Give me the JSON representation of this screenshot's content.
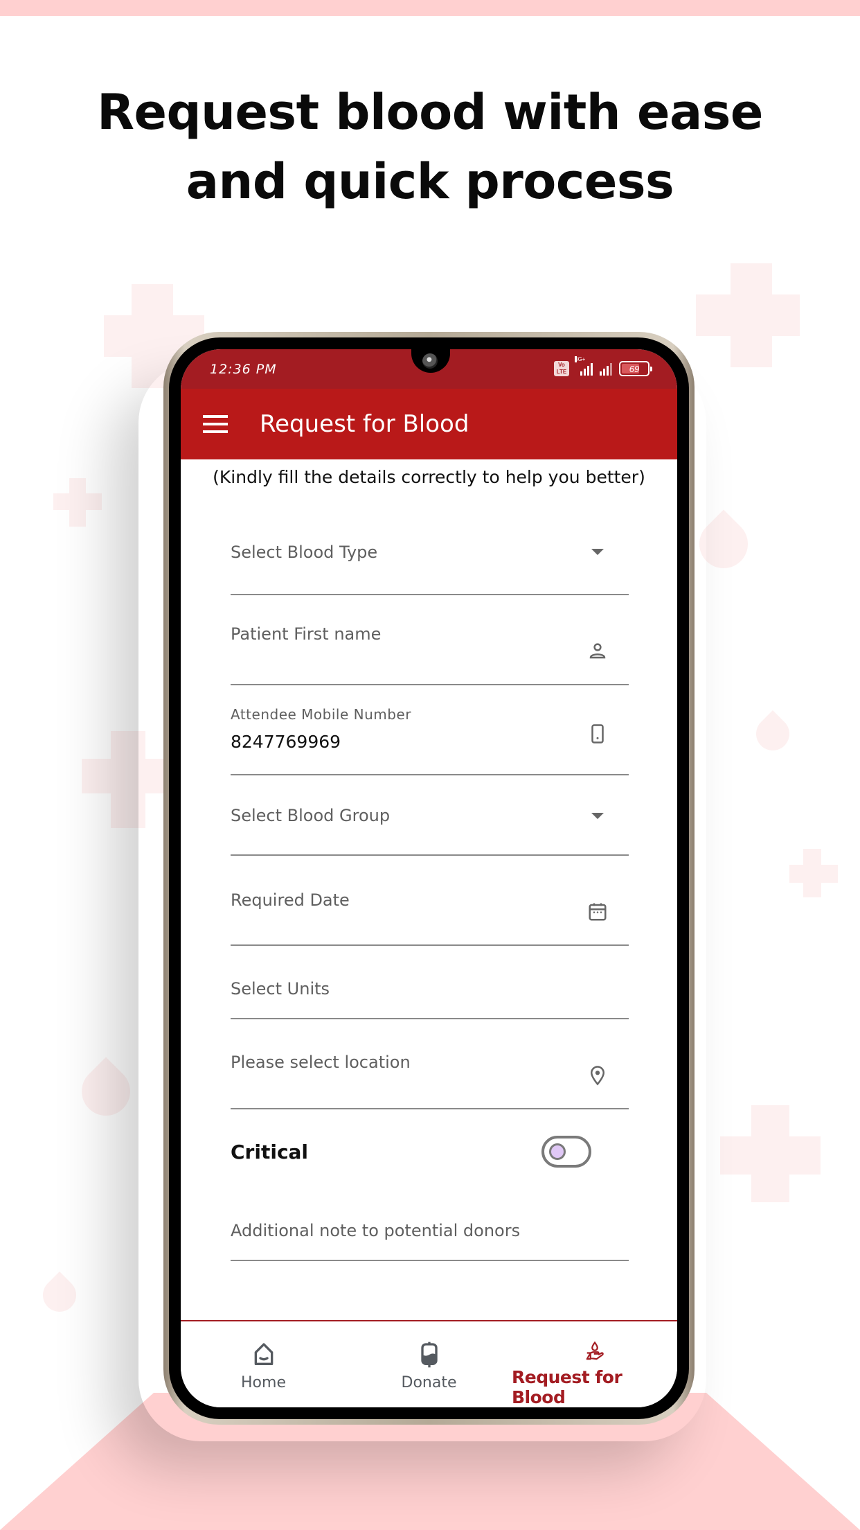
{
  "marketing": {
    "headline_line1": "Request blood with ease",
    "headline_line2": "and quick process"
  },
  "colors": {
    "brand_red": "#b91919",
    "status_bar_red": "#a31c22",
    "background_pink": "#ffd0d0",
    "toggle_knob": "#e0c8f6"
  },
  "status_bar": {
    "time": "12:36 PM",
    "volte_icon": "volte-icon",
    "network_label": "4G+",
    "battery_percent": "69",
    "battery_level": 0.69
  },
  "app_bar": {
    "menu_icon": "hamburger-menu-icon",
    "title": "Request for Blood"
  },
  "form": {
    "instructions": "(Kindly fill the details correctly to help you better)",
    "fields": [
      {
        "key": "blood_type",
        "placeholder": "Select Blood Type",
        "value": "",
        "icon": "dropdown-caret-icon"
      },
      {
        "key": "patient_first_name",
        "placeholder": "Patient First name",
        "value": "",
        "icon": "person-icon"
      },
      {
        "key": "attendee_mobile",
        "label": "Attendee Mobile Number",
        "value": "8247769969",
        "icon": "smartphone-icon"
      },
      {
        "key": "blood_group",
        "placeholder": "Select Blood Group",
        "value": "",
        "icon": "dropdown-caret-icon"
      },
      {
        "key": "required_date",
        "placeholder": "Required Date",
        "value": "",
        "icon": "calendar-icon"
      },
      {
        "key": "units",
        "placeholder": "Select Units",
        "value": ""
      },
      {
        "key": "location",
        "placeholder": "Please select location",
        "value": "",
        "icon": "location-pin-icon"
      },
      {
        "key": "additional_note",
        "placeholder": "Additional note to potential donors",
        "value": ""
      }
    ],
    "critical": {
      "label": "Critical",
      "checked": false
    }
  },
  "bottom_nav": {
    "items": [
      {
        "label": "Home",
        "icon": "home-icon",
        "active": false
      },
      {
        "label": "Donate",
        "icon": "blood-bag-icon",
        "active": false
      },
      {
        "label": "Request for Blood",
        "icon": "hand-blood-drop-icon",
        "active": true
      }
    ]
  }
}
